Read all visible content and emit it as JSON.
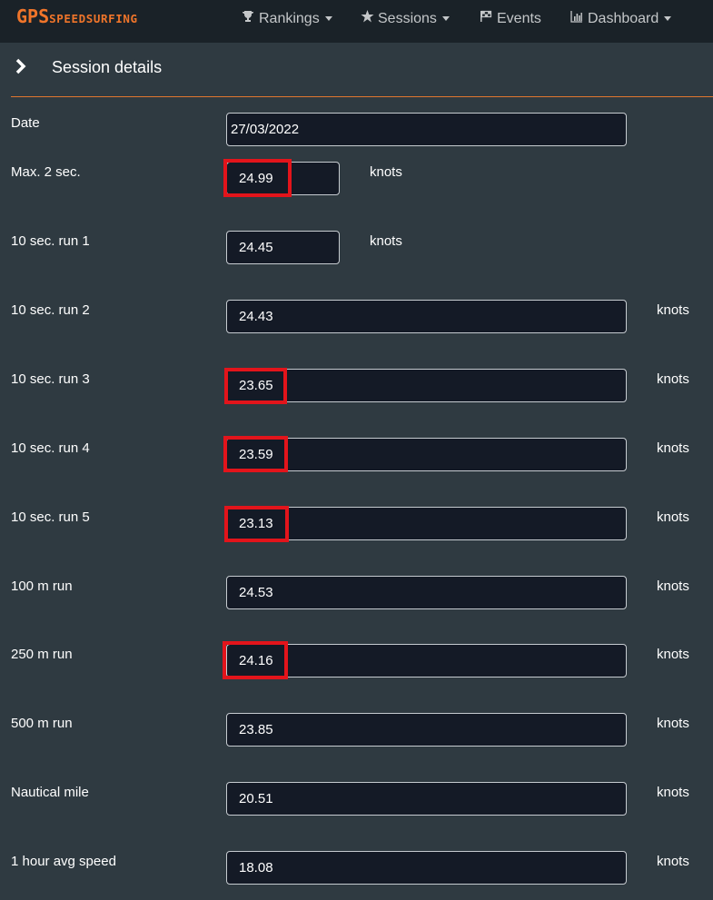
{
  "nav": {
    "logo_big": "GPS",
    "logo_small": "SPEEDSURFING",
    "items": [
      {
        "label": "Rankings",
        "icon": "trophy-icon"
      },
      {
        "label": "Sessions",
        "icon": "star-icon"
      },
      {
        "label": "Events",
        "icon": "flag-icon"
      },
      {
        "label": "Dashboard",
        "icon": "bar-chart-icon"
      }
    ]
  },
  "section": {
    "title": "Session details",
    "icon": "chevron-right-icon"
  },
  "colors": {
    "accent": "#f0752a",
    "highlight": "#e3141b",
    "background": "#2f3a41",
    "navbar": "#1a2228",
    "field": "#141a26"
  },
  "fields": [
    {
      "label": "Date",
      "value": "27/03/2022",
      "unit": ""
    },
    {
      "label": "Max. 2 sec.",
      "value": "24.99",
      "unit": "knots",
      "highlighted": true
    },
    {
      "label": "10 sec. run 1",
      "value": "24.45",
      "unit": "knots"
    },
    {
      "label": "10 sec. run 2",
      "value": "24.43",
      "unit": "knots"
    },
    {
      "label": "10 sec. run 3",
      "value": "23.65",
      "unit": "knots",
      "highlighted": true
    },
    {
      "label": "10 sec. run 4",
      "value": "23.59",
      "unit": "knots",
      "highlighted": true
    },
    {
      "label": "10 sec. run 5",
      "value": "23.13",
      "unit": "knots",
      "highlighted": true
    },
    {
      "label": "100 m run",
      "value": "24.53",
      "unit": "knots"
    },
    {
      "label": "250 m run",
      "value": "24.16",
      "unit": "knots",
      "highlighted": true
    },
    {
      "label": "500 m run",
      "value": "23.85",
      "unit": "knots"
    },
    {
      "label": "Nautical mile",
      "value": "20.51",
      "unit": "knots"
    },
    {
      "label": "1 hour avg speed",
      "value": "18.08",
      "unit": "knots"
    }
  ]
}
